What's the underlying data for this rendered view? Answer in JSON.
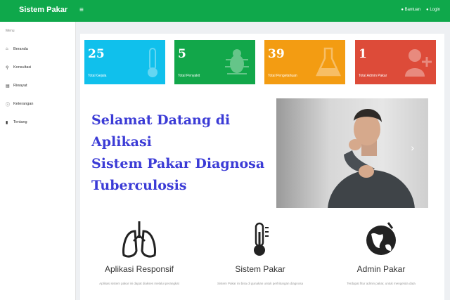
{
  "header": {
    "brand": "Sistem Pakar",
    "menu_icon": "hamburger-icon",
    "links": [
      {
        "label": "Bantuan",
        "icon": "help-icon"
      },
      {
        "label": "Login",
        "icon": "login-icon"
      }
    ],
    "color": "#0fa84b"
  },
  "sidebar": {
    "heading": "Menu",
    "items": [
      {
        "label": "Beranda",
        "icon": "home-icon"
      },
      {
        "label": "Konsultasi",
        "icon": "search-icon"
      },
      {
        "label": "Riwayat",
        "icon": "history-icon"
      },
      {
        "label": "Keterangan",
        "icon": "info-icon"
      },
      {
        "label": "Tentang",
        "icon": "about-icon"
      }
    ]
  },
  "stats": [
    {
      "value": "25",
      "label": "Total Gejala",
      "color": "#10c0ec",
      "icon": "thermometer-icon"
    },
    {
      "value": "5",
      "label": "Total Penyakit",
      "color": "#12a74a",
      "icon": "bug-icon"
    },
    {
      "value": "39",
      "label": "Total Pengetahuan",
      "color": "#f39c12",
      "icon": "flask-icon"
    },
    {
      "value": "1",
      "label": "Total Admin Pakar",
      "color": "#dd4b39",
      "icon": "user-add-icon"
    }
  ],
  "welcome": {
    "lines": [
      "Selamat Datang di Aplikasi",
      "Sistem Pakar Diagnosa",
      "Tuberculosis"
    ],
    "color": "#3b3bd6"
  },
  "hero": {
    "image": "man-coughing-photo",
    "next_icon": "chevron-right-icon"
  },
  "features": [
    {
      "title": "Aplikasi Responsif",
      "desc": "Aplikasi sistem pakar ini dapat diakses melalui perangkat",
      "icon": "lungs-icon"
    },
    {
      "title": "Sistem Pakar",
      "desc": "Sistem Pakar ini bisa di gunakan untuk perhitungan diagnosa",
      "icon": "thermometer-icon"
    },
    {
      "title": "Admin Pakar",
      "desc": "Terdapat fitur admin pakar, untuk mengelola data",
      "icon": "globe-icon"
    }
  ]
}
